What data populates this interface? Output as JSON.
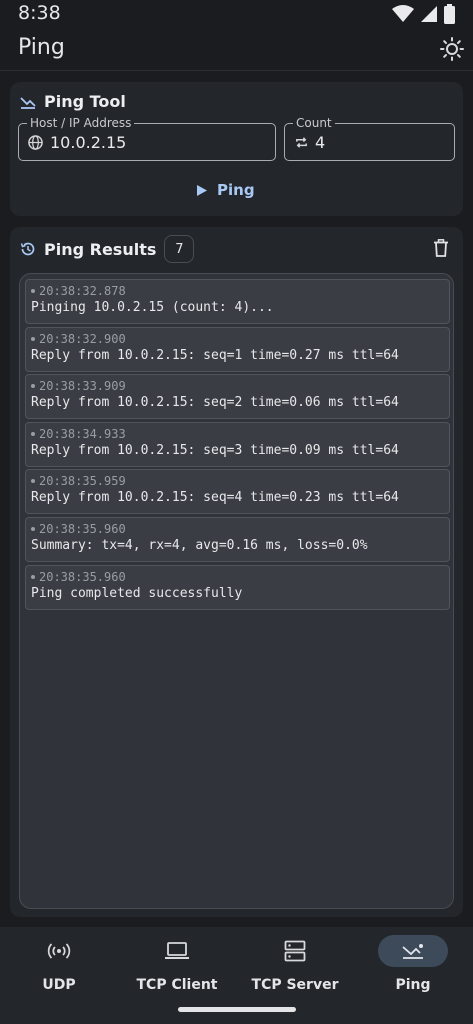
{
  "status": {
    "time": "8:38"
  },
  "app": {
    "title": "Ping"
  },
  "tool": {
    "title": "Ping Tool",
    "host": {
      "label": "Host / IP Address",
      "value": "10.0.2.15"
    },
    "count": {
      "label": "Count",
      "value": "4"
    },
    "button_label": "Ping"
  },
  "results": {
    "title": "Ping Results",
    "count_badge": "7",
    "entries": [
      {
        "time": "20:38:32.878",
        "message": "Pinging 10.0.2.15 (count: 4)..."
      },
      {
        "time": "20:38:32.900",
        "message": "Reply from 10.0.2.15: seq=1 time=0.27 ms ttl=64"
      },
      {
        "time": "20:38:33.909",
        "message": "Reply from 10.0.2.15: seq=2 time=0.06 ms ttl=64"
      },
      {
        "time": "20:38:34.933",
        "message": "Reply from 10.0.2.15: seq=3 time=0.09 ms ttl=64"
      },
      {
        "time": "20:38:35.959",
        "message": "Reply from 10.0.2.15: seq=4 time=0.23 ms ttl=64"
      },
      {
        "time": "20:38:35.960",
        "message": "Summary: tx=4, rx=4, avg=0.16 ms, loss=0.0%"
      },
      {
        "time": "20:38:35.960",
        "message": "Ping completed successfully"
      }
    ]
  },
  "nav": {
    "items": [
      {
        "label": "UDP",
        "icon": "broadcast-icon",
        "active": false
      },
      {
        "label": "TCP Client",
        "icon": "laptop-icon",
        "active": false
      },
      {
        "label": "TCP Server",
        "icon": "server-icon",
        "active": false
      },
      {
        "label": "Ping",
        "icon": "ping-icon",
        "active": true
      }
    ]
  },
  "colors": {
    "accent": "#a9c9f5",
    "background": "#1a1c1f",
    "card": "#23262a",
    "nav_active": "#3d4a5a"
  }
}
